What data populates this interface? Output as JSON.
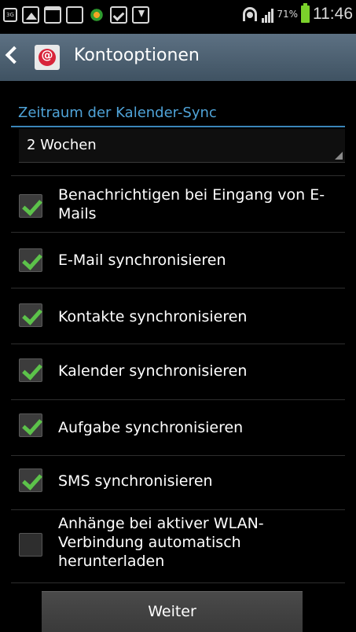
{
  "status_bar": {
    "icons": [
      "3g-icon",
      "gallery-icon",
      "calendar-icon",
      "mail-icon",
      "flower-icon",
      "check-clipboard-icon",
      "download-icon"
    ],
    "badge_3g": "3G",
    "battery_percent": "71%",
    "battery_level": 0.71,
    "time": "11:46"
  },
  "action_bar": {
    "title": "Kontooptionen"
  },
  "calendar_sync": {
    "label": "Zeitraum der Kalender-Sync",
    "value": "2 Wochen"
  },
  "options": [
    {
      "label": "Benachrichtigen bei Eingang von E-Mails",
      "checked": true
    },
    {
      "label": "E-Mail synchronisieren",
      "checked": true
    },
    {
      "label": "Kontakte synchronisieren",
      "checked": true
    },
    {
      "label": "Kalender synchronisieren",
      "checked": true
    },
    {
      "label": "Aufgabe synchronisieren",
      "checked": true
    },
    {
      "label": "SMS synchronisieren",
      "checked": true
    },
    {
      "label": "Anhänge bei aktiver WLAN-Verbindung automatisch herunterladen",
      "checked": false
    }
  ],
  "footer": {
    "next_label": "Weiter"
  },
  "colors": {
    "accent": "#4fa3d8",
    "check": "#5cc24a",
    "action_bar": "#4f6272"
  }
}
